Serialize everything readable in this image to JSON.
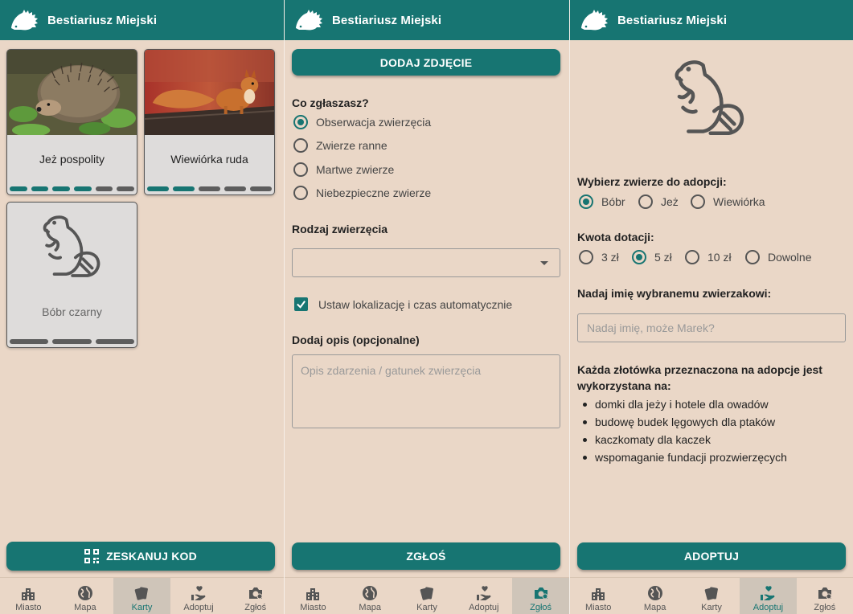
{
  "app_title": "Bestiariusz Miejski",
  "nav": [
    "Miasto",
    "Mapa",
    "Karty",
    "Adoptuj",
    "Zgłoś"
  ],
  "cards_screen": {
    "cards": [
      {
        "name": "Jeż pospolity",
        "progress": {
          "filled": 4,
          "total": 6
        }
      },
      {
        "name": "Wiewiórka ruda",
        "progress": {
          "filled": 2,
          "total": 5
        }
      },
      {
        "name": "Bóbr czarny",
        "progress": {
          "filled": 0,
          "total": 3
        }
      }
    ],
    "scan_button": "ZESKANUJ KOD"
  },
  "report_screen": {
    "add_photo_button": "DODAJ ZDJĘCIE",
    "question": "Co zgłaszasz?",
    "options": [
      "Obserwacja zwierzęcia",
      "Zwierze ranne",
      "Martwe zwierze",
      "Niebezpieczne zwierze"
    ],
    "selected_option": "Obserwacja zwierzęcia",
    "animal_type_label": "Rodzaj zwierzęcia",
    "animal_type_value": "",
    "auto_location_label": "Ustaw lokalizację i czas automatycznie",
    "auto_location_checked": true,
    "description_label": "Dodaj opis (opcjonalne)",
    "description_placeholder": "Opis zdarzenia / gatunek zwierzęcia",
    "submit_button": "ZGŁOŚ"
  },
  "adopt_screen": {
    "choose_label": "Wybierz zwierze do adopcji:",
    "animals": [
      "Bóbr",
      "Jeż",
      "Wiewiórka"
    ],
    "selected_animal": "Bóbr",
    "amount_label": "Kwota dotacji:",
    "amounts": [
      "3 zł",
      "5 zł",
      "10 zł",
      "Dowolne"
    ],
    "selected_amount": "5 zł",
    "name_label": "Nadaj imię wybranemu zwierzakowi:",
    "name_placeholder": "Nadaj imię, może Marek?",
    "info_title": "Każda złotówka przeznaczona na adopcje jest wykorzystana na:",
    "info_items": [
      "domki dla jeży i hotele dla owadów",
      "budowę budek lęgowych dla ptaków",
      "kaczkomaty dla kaczek",
      "wspomaganie fundacji prozwierzęcych"
    ],
    "adopt_button": "ADOPTUJ"
  },
  "colors": {
    "primary": "#177572",
    "background": "#ead7c7",
    "card": "#dedcdb"
  },
  "icons": [
    "hedgehog-logo-icon",
    "city-icon",
    "globe-icon",
    "cards-icon",
    "adopt-hand-heart-icon",
    "camera-location-icon",
    "qr-code-icon",
    "beaver-icon",
    "dropdown-arrow-icon",
    "checkmark-icon"
  ]
}
